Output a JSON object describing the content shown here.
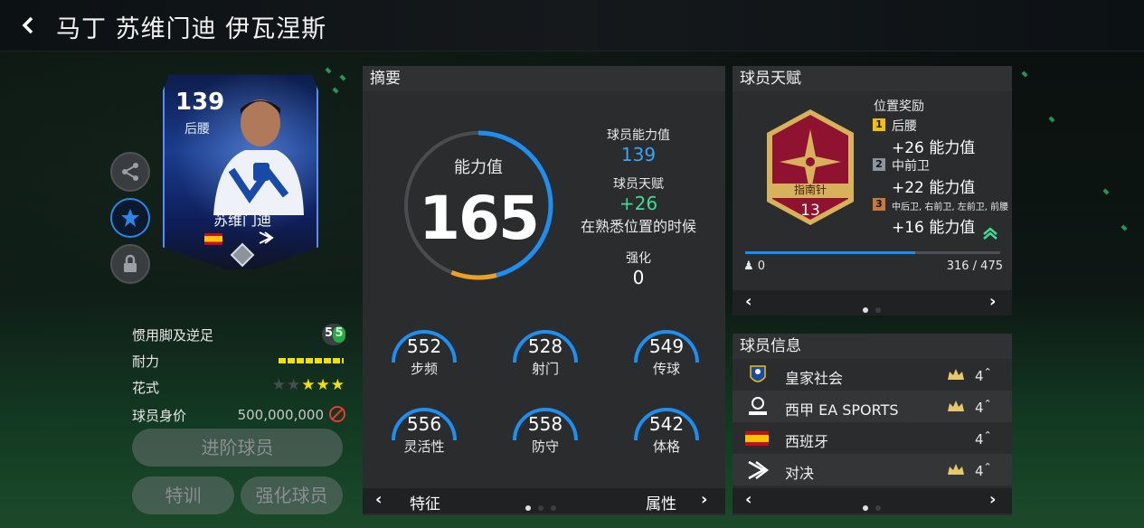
{
  "header": {
    "title": "马丁 苏维门迪 伊瓦涅斯"
  },
  "card": {
    "rating": "139",
    "position": "后腰",
    "name": "苏维门迪"
  },
  "attributes": {
    "weak_foot": {
      "label": "惯用脚及逆足",
      "value_a": "5",
      "value_b": "5"
    },
    "stamina": {
      "label": "耐力"
    },
    "skill_moves": {
      "label": "花式",
      "stars_on": 3,
      "stars_total": 5
    },
    "value": {
      "label": "球员身价",
      "amount": "500,000,000"
    }
  },
  "buttons": {
    "advance": "进阶球员",
    "train": "特训",
    "enhance": "强化球员"
  },
  "summary": {
    "title": "摘要",
    "ovr_label": "能力值",
    "ovr_value": "165",
    "ring_fraction": 0.68,
    "base_label": "球员能力值",
    "base_value": "139",
    "talent_label": "球员天赋",
    "talent_value": "+26",
    "talent_note": "在熟悉位置的时候",
    "enhance_label": "强化",
    "enhance_value": "0",
    "stats": [
      {
        "value": "552",
        "name": "步频"
      },
      {
        "value": "528",
        "name": "射门"
      },
      {
        "value": "549",
        "name": "传球"
      },
      {
        "value": "556",
        "name": "灵活性"
      },
      {
        "value": "558",
        "name": "防守"
      },
      {
        "value": "542",
        "name": "体格"
      }
    ],
    "footer_left": "特征",
    "footer_right": "属性"
  },
  "talent": {
    "title": "球员天赋",
    "badge_name": "指南针",
    "badge_level": "13",
    "bonus_title": "位置奖励",
    "bonuses": [
      {
        "rank": "1",
        "position": "后腰",
        "gain": "+26 能力值"
      },
      {
        "rank": "2",
        "position": "中前卫",
        "gain": "+22 能力值"
      },
      {
        "rank": "3",
        "position": "中后卫, 右前卫, 左前卫, 前腰",
        "gain": "+16 能力值"
      }
    ],
    "tokens": "0",
    "progress_text": "316 / 475",
    "progress_fraction": 0.665
  },
  "info": {
    "title": "球员信息",
    "rows": [
      {
        "name": "皇家社会",
        "count": "4"
      },
      {
        "name": "西甲 EA SPORTS",
        "count": "4"
      },
      {
        "name": "西班牙",
        "count": "4"
      },
      {
        "name": "对决",
        "count": "4"
      }
    ]
  },
  "colors": {
    "accent_blue": "#35a4ff",
    "talent_green": "#3ddc97",
    "badge_red": "#8f1230",
    "badge_gold": "#d8b25a"
  },
  "icons": [
    "back-icon",
    "share-icon",
    "star-icon",
    "lock-icon",
    "ban-icon",
    "crown-icon",
    "chevron-left-icon",
    "chevron-right-icon"
  ]
}
